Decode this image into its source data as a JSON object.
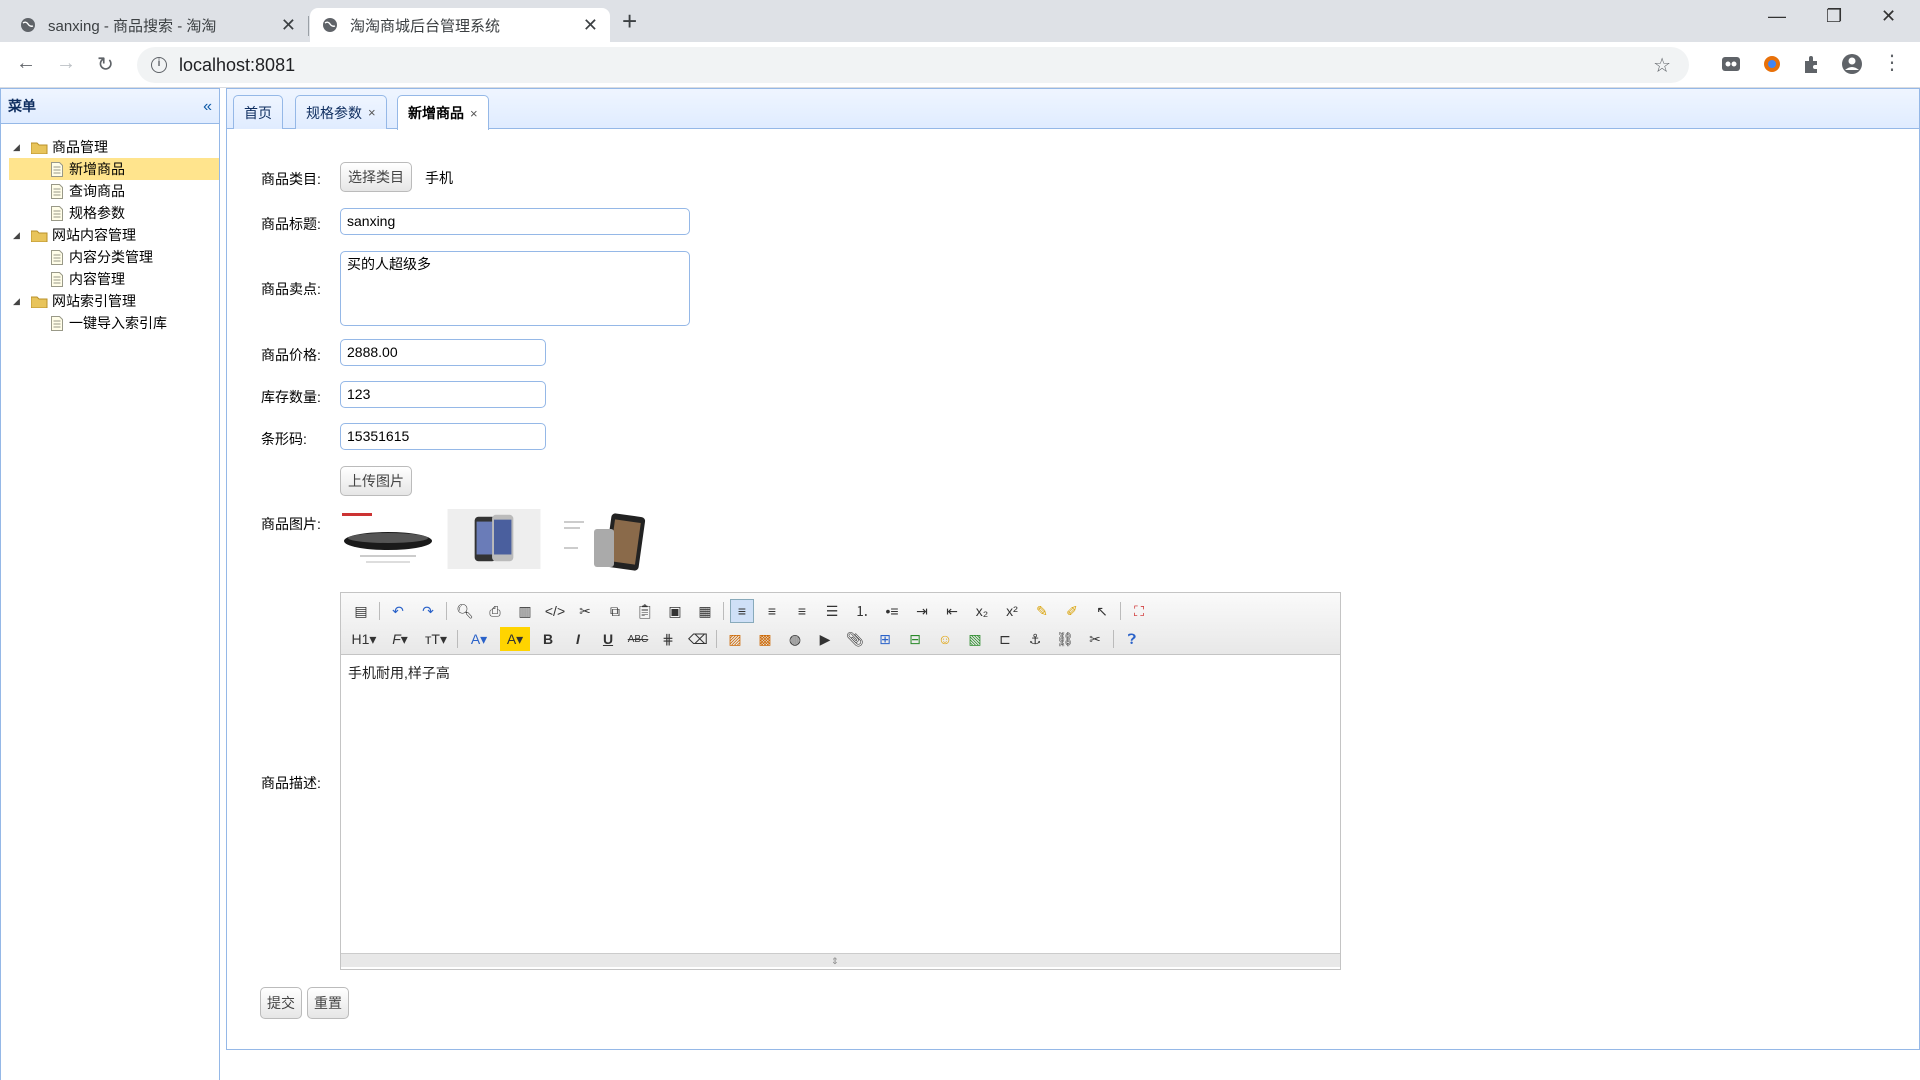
{
  "browser": {
    "tabs": [
      {
        "title": "sanxing - 商品搜索 - 淘淘",
        "active": false
      },
      {
        "title": "淘淘商城后台管理系统",
        "active": true
      }
    ],
    "url": "localhost:8081"
  },
  "sidebar": {
    "title": "菜单",
    "groups": [
      {
        "label": "商品管理",
        "items": [
          "新增商品",
          "查询商品",
          "规格参数"
        ]
      },
      {
        "label": "网站内容管理",
        "items": [
          "内容分类管理",
          "内容管理"
        ]
      },
      {
        "label": "网站索引管理",
        "items": [
          "一键导入索引库"
        ]
      }
    ],
    "selected": "新增商品"
  },
  "page_tabs": [
    {
      "label": "首页",
      "closable": false
    },
    {
      "label": "规格参数",
      "closable": true
    },
    {
      "label": "新增商品",
      "closable": true,
      "active": true
    }
  ],
  "form": {
    "category_label": "商品类目:",
    "category_button": "选择类目",
    "category_value": "手机",
    "title_label": "商品标题:",
    "title_value": "sanxing",
    "sellpoint_label": "商品卖点:",
    "sellpoint_value": "买的人超级多",
    "price_label": "商品价格:",
    "price_value": "2888.00",
    "stock_label": "库存数量:",
    "stock_value": "123",
    "barcode_label": "条形码:",
    "barcode_value": "15351615",
    "upload_button": "上传图片",
    "image_label": "商品图片:",
    "desc_label": "商品描述:",
    "desc_value": "手机耐用,样子高",
    "submit_button": "提交",
    "reset_button": "重置"
  },
  "colors": {
    "panel_border": "#95b8e7",
    "header_bg": "#e0ecff",
    "selected_bg": "#ffe48d"
  }
}
